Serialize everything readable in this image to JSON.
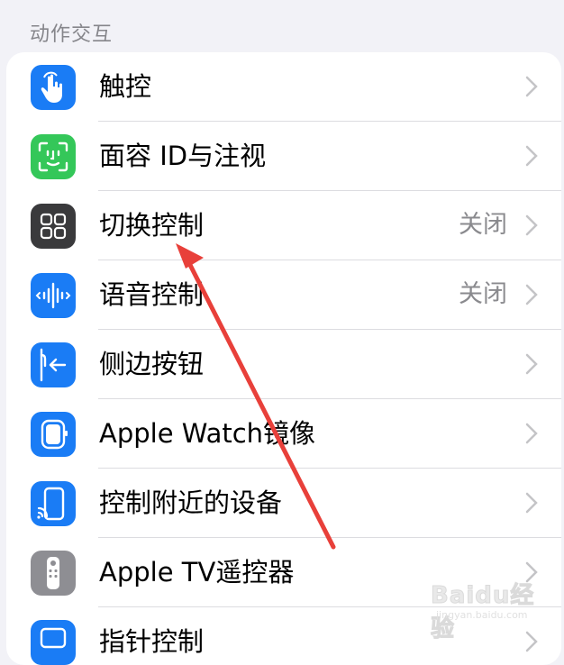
{
  "section": {
    "title": "动作交互"
  },
  "rows": [
    {
      "label": "触控",
      "value": "",
      "icon": "hand-tap-icon",
      "color": "#1a7cf5"
    },
    {
      "label": "面容 ID与注视",
      "value": "",
      "icon": "face-id-icon",
      "color": "#34c759"
    },
    {
      "label": "切换控制",
      "value": "关闭",
      "icon": "switch-control-icon",
      "color": "#3a3a3c"
    },
    {
      "label": "语音控制",
      "value": "关闭",
      "icon": "voice-control-icon",
      "color": "#1a7cf5"
    },
    {
      "label": "侧边按钮",
      "value": "",
      "icon": "side-button-icon",
      "color": "#1a7cf5"
    },
    {
      "label": "Apple Watch镜像",
      "value": "",
      "icon": "apple-watch-icon",
      "color": "#1a7cf5"
    },
    {
      "label": "控制附近的设备",
      "value": "",
      "icon": "nearby-devices-icon",
      "color": "#1a7cf5"
    },
    {
      "label": "Apple TV遥控器",
      "value": "",
      "icon": "tv-remote-icon",
      "color": "#8e8e93"
    },
    {
      "label": "指针控制",
      "value": "",
      "icon": "pointer-control-icon",
      "color": "#1a7cf5"
    }
  ],
  "annotation": {
    "arrow_color": "#e8403a"
  },
  "watermark": {
    "logo": "Baidu经验",
    "sub": "jingyan.baidu.com"
  }
}
